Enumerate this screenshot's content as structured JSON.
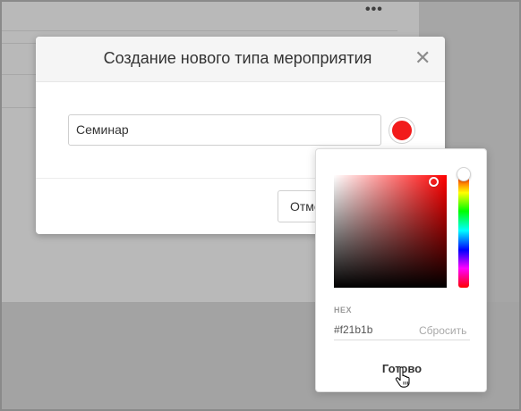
{
  "background": {
    "menu_icon": "more-horizontal-icon",
    "menu_glyph": "•••"
  },
  "modal": {
    "title": "Создание нового типа мероприятия",
    "close_glyph": "✕",
    "name_input_value": "Семинар",
    "selected_color": "#f21b1b",
    "cancel_label": "Отмена"
  },
  "picker": {
    "hex_label": "HEX",
    "hex_value": "#f21b1b",
    "reset_label": "Сбросить",
    "done_label": "Готово",
    "hue_color": "#ff0000"
  }
}
